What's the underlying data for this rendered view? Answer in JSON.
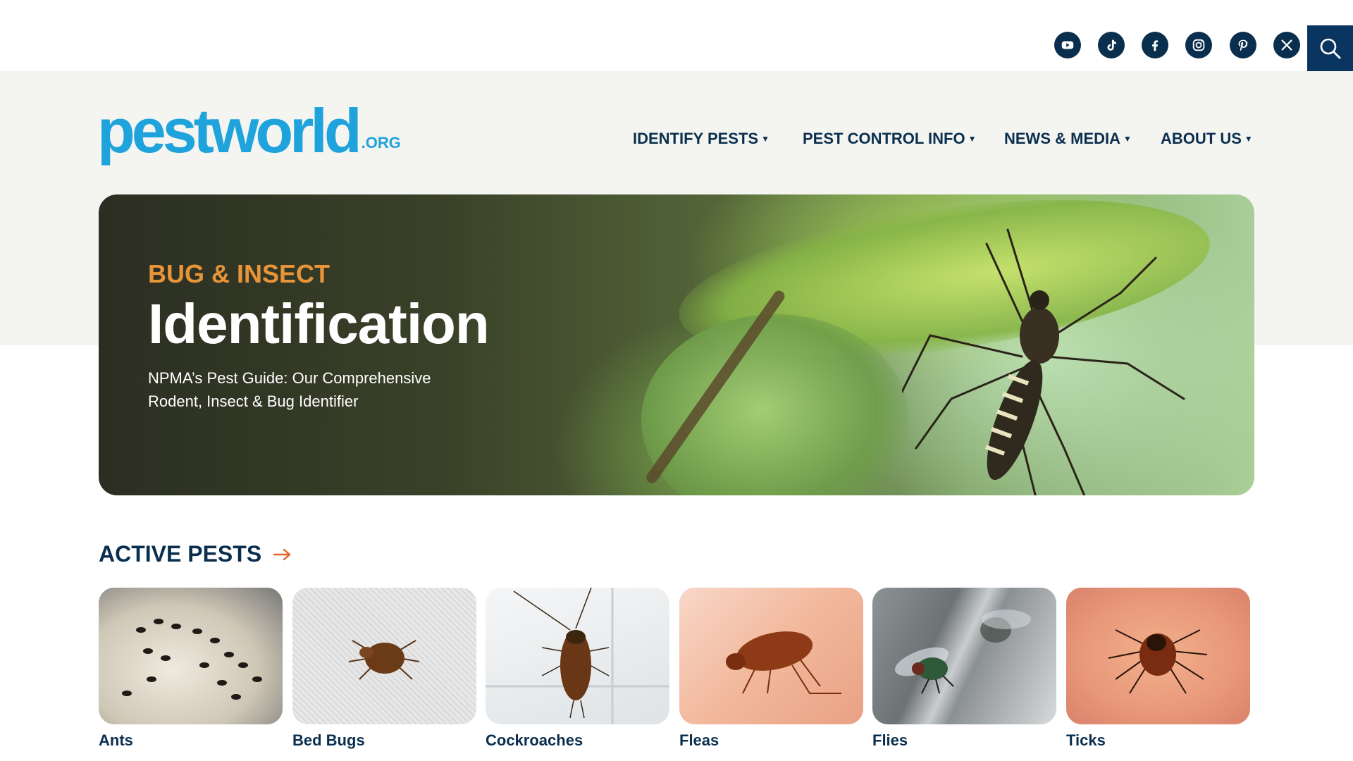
{
  "header": {
    "social_icons": [
      "youtube-icon",
      "tiktok-icon",
      "facebook-icon",
      "instagram-icon",
      "pinterest-icon",
      "x-icon"
    ],
    "logo_main": "pestworld",
    "logo_suffix": ".ORG",
    "nav": [
      {
        "label": "IDENTIFY PESTS"
      },
      {
        "label": "PEST CONTROL INFO"
      },
      {
        "label": "NEWS & MEDIA"
      },
      {
        "label": "ABOUT US"
      }
    ],
    "colors": {
      "navy": "#0a2f4e",
      "brand_blue": "#1fa3dc",
      "accent_orange": "#e8953a"
    }
  },
  "hero": {
    "kicker": "BUG & INSECT",
    "title": "Identification",
    "subtitle": "NPMA’s Pest Guide: Our Comprehensive Rodent, Insect & Bug Identifier"
  },
  "active_pests": {
    "title": "ACTIVE PESTS",
    "items": [
      {
        "label": "Ants"
      },
      {
        "label": "Bed Bugs"
      },
      {
        "label": "Cockroaches"
      },
      {
        "label": "Fleas"
      },
      {
        "label": "Flies"
      },
      {
        "label": "Ticks"
      }
    ]
  }
}
